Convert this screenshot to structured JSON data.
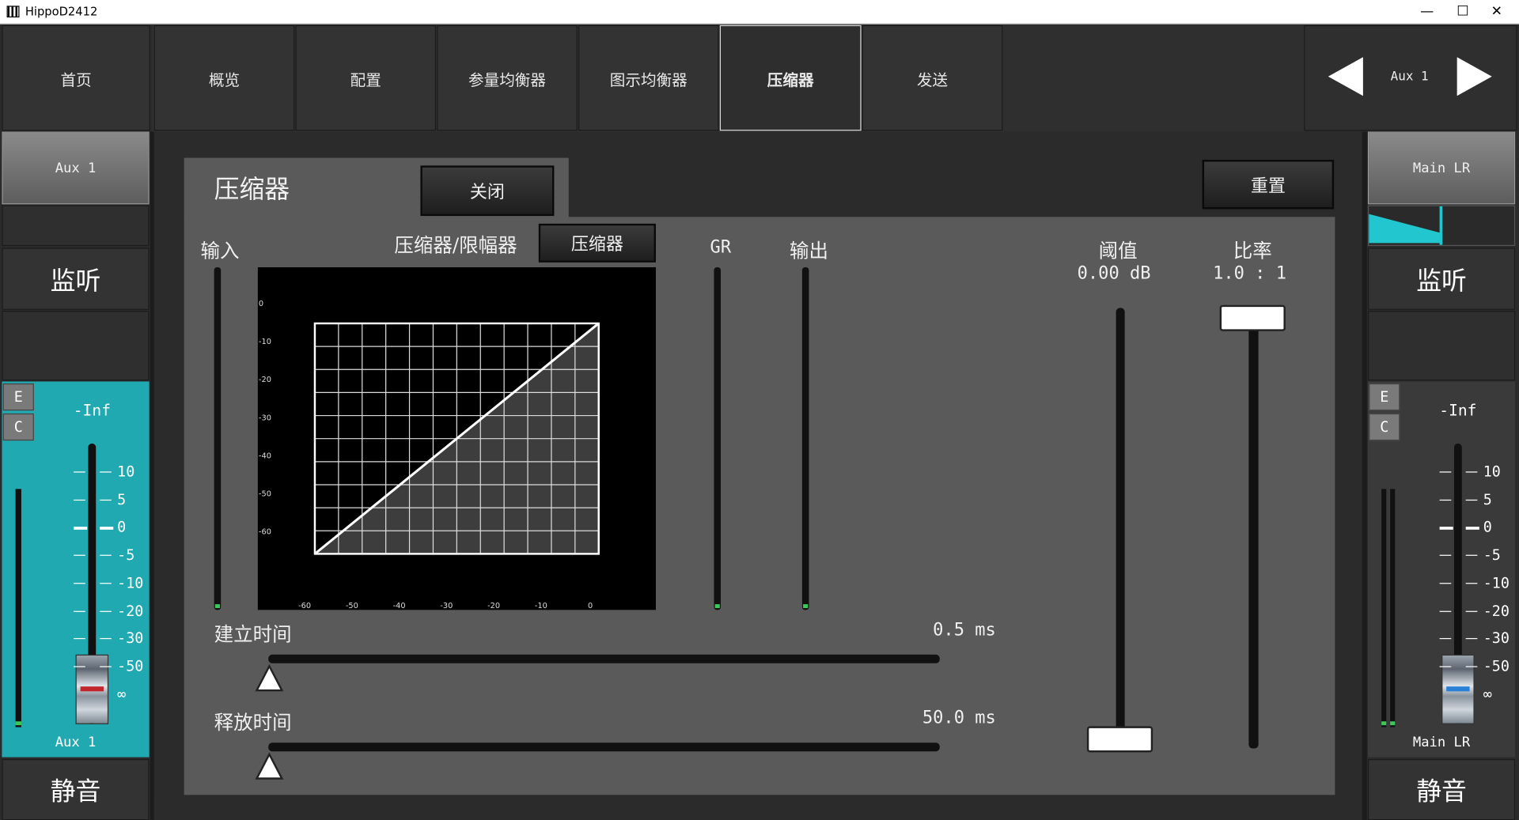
{
  "window": {
    "title": "HippoD2412",
    "minimize": "—",
    "maximize": "☐",
    "close": "✕"
  },
  "nav": {
    "home": "首页",
    "tabs": [
      {
        "label": "概览"
      },
      {
        "label": "配置"
      },
      {
        "label": "参量均衡器"
      },
      {
        "label": "图示均衡器"
      },
      {
        "label": "压缩器",
        "active": true
      },
      {
        "label": "发送"
      }
    ],
    "bus_label": "Aux 1"
  },
  "left_strip": {
    "channel_button": "Aux 1",
    "monitor_label": "监听",
    "e_label": "E",
    "c_label": "C",
    "level_readout": "-Inf",
    "scale": [
      "10",
      "5",
      "0",
      "-5",
      "-10",
      "-20",
      "-30",
      "-50",
      "∞"
    ],
    "fader_value_db": "-Inf",
    "channel_name": "Aux 1",
    "mute_label": "静音",
    "strip_color": "#21a9b1"
  },
  "right_strip": {
    "channel_button": "Main LR",
    "pan_fraction": 0.5,
    "monitor_label": "监听",
    "e_label": "E",
    "c_label": "C",
    "level_readout": "-Inf",
    "scale": [
      "10",
      "5",
      "0",
      "-5",
      "-10",
      "-20",
      "-30",
      "-50",
      "∞"
    ],
    "channel_name": "Main LR",
    "mute_label": "静音"
  },
  "compressor": {
    "title": "压缩器",
    "power_button": "关闭",
    "reset_button": "重置",
    "input_label": "输入",
    "mode_label": "压缩器/限幅器",
    "mode_button": "压缩器",
    "gr_label": "GR",
    "output_label": "输出",
    "threshold_label": "阈值",
    "threshold_value": "0.00 dB",
    "threshold_fraction": 0.0,
    "ratio_label": "比率",
    "ratio_value": "1.0 : 1",
    "ratio_fraction": 0.0,
    "attack_label": "建立时间",
    "attack_value": "0.5 ms",
    "attack_fraction": 0.0,
    "release_label": "释放时间",
    "release_value": "50.0 ms",
    "release_fraction": 0.0,
    "graph": {
      "y_ticks": [
        "0",
        "-10",
        "-20",
        "-30",
        "-40",
        "-50",
        "-60"
      ],
      "x_ticks": [
        "-60",
        "-50",
        "-40",
        "-30",
        "-20",
        "-10",
        "0"
      ]
    }
  }
}
